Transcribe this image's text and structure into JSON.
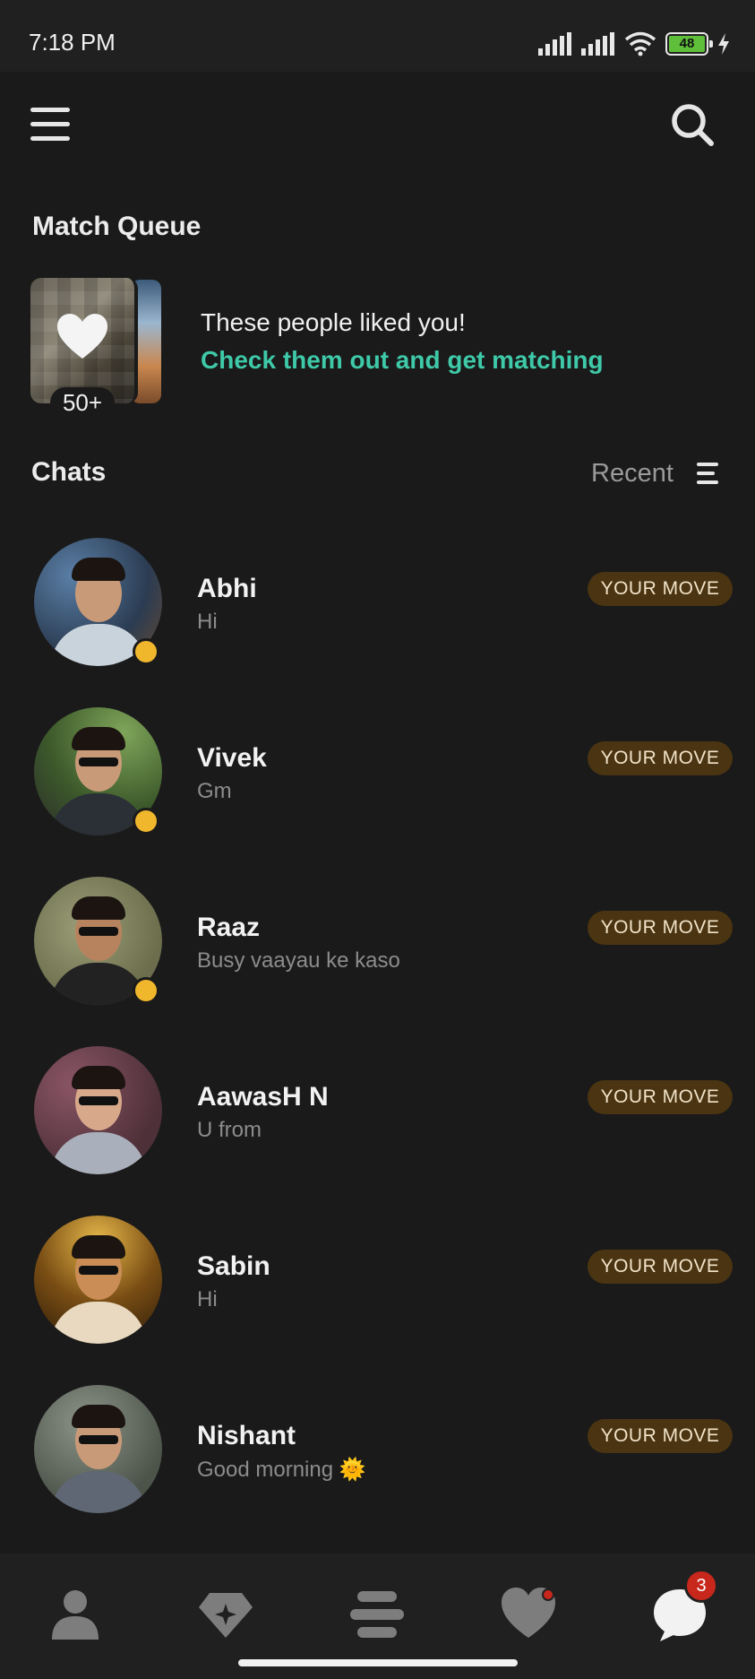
{
  "status_bar": {
    "time": "7:18 PM",
    "battery_level": "48",
    "icons": [
      "signal-icon",
      "signal-icon",
      "wifi-icon",
      "battery-icon",
      "charging-icon"
    ]
  },
  "header": {
    "menu_icon": "hamburger-menu-icon",
    "search_icon": "search-icon"
  },
  "match_queue": {
    "title": "Match Queue",
    "count": "50+",
    "line1": "These people liked you!",
    "line2": "Check them out and get matching",
    "accent_color": "#3ec9a8"
  },
  "chats": {
    "title": "Chats",
    "sort_label": "Recent",
    "badge_label": "YOUR MOVE",
    "items": [
      {
        "name": "Abhi",
        "message": "Hi",
        "online": true
      },
      {
        "name": "Vivek",
        "message": "Gm",
        "online": true
      },
      {
        "name": "Raaz",
        "message": "Busy vaayau ke kaso",
        "online": true
      },
      {
        "name": "AawasH N",
        "message": "U from",
        "online": false
      },
      {
        "name": "Sabin",
        "message": "Hi",
        "online": false
      },
      {
        "name": "Nishant",
        "message": "Good morning 🌞",
        "online": false
      }
    ]
  },
  "bottom_nav": {
    "items": [
      "profile-icon",
      "discover-icon",
      "feed-icon",
      "likes-icon",
      "chat-icon"
    ],
    "chat_badge": "3"
  }
}
